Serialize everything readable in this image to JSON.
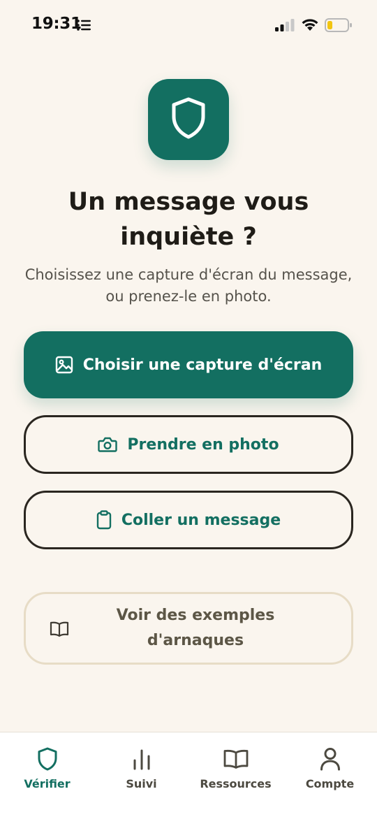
{
  "status_bar": {
    "time": "19:31"
  },
  "hero": {
    "icon": "shield-icon",
    "headline_line1": "Un message vous",
    "headline_line2": "inquiète ?",
    "subtext_line1": "Choisissez une capture d'écran du message,",
    "subtext_line2": "ou prenez-le en photo."
  },
  "actions": {
    "choose_screenshot": {
      "label": "Choisir une capture d'écran",
      "icon": "image-icon"
    },
    "take_photo": {
      "label": "Prendre en photo",
      "icon": "camera-icon"
    },
    "paste_message": {
      "label": "Coller un message",
      "icon": "clipboard-icon"
    },
    "examples": {
      "label_line1": "Voir des exemples",
      "label_line2": "d'arnaques",
      "icon": "book-icon"
    }
  },
  "tab_bar": {
    "tabs": [
      {
        "label": "Vérifier",
        "icon": "shield-icon",
        "active": true
      },
      {
        "label": "Suivi",
        "icon": "bar-chart-icon",
        "active": false
      },
      {
        "label": "Ressources",
        "icon": "book-icon",
        "active": false
      },
      {
        "label": "Compte",
        "icon": "user-icon",
        "active": false
      }
    ]
  },
  "colors": {
    "background": "#faf5ee",
    "primary": "#136f61",
    "text": "#1f1c17",
    "muted_text": "#55524b",
    "outline_dark": "#2a2620",
    "outline_light": "#e7dcc6"
  }
}
